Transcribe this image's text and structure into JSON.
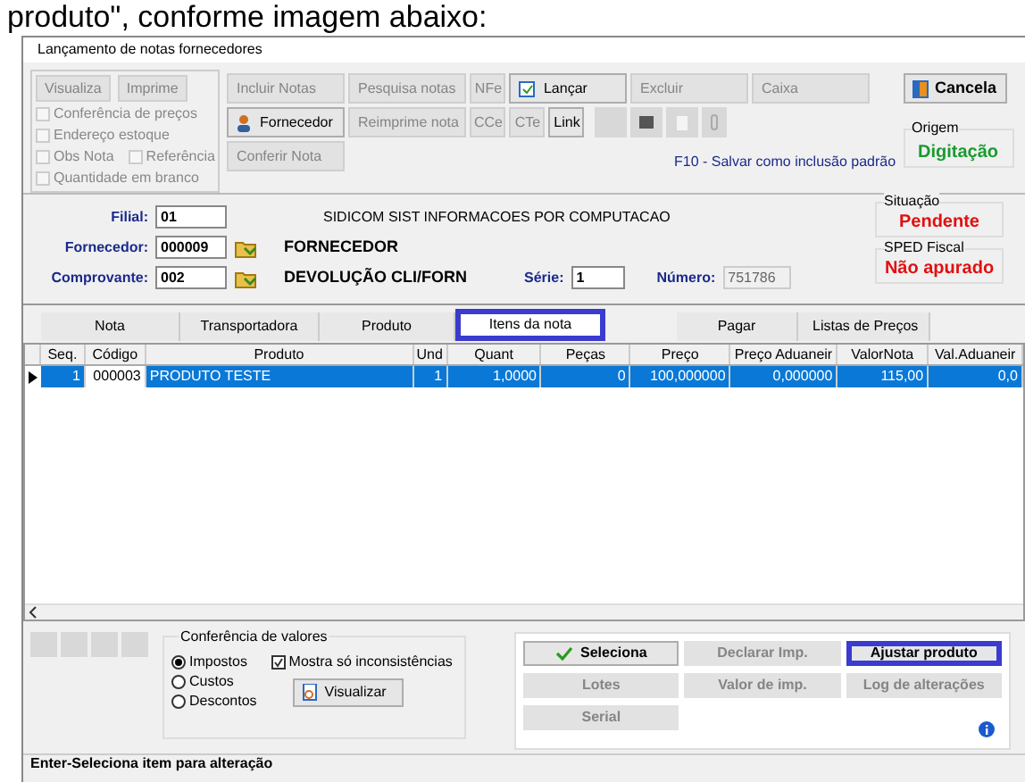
{
  "heading": "produto\", conforme imagem abaixo:",
  "window": {
    "title": "Lançamento de notas fornecedores"
  },
  "left_tools": {
    "buttons": [
      {
        "label": "Visualiza",
        "disabled": true
      },
      {
        "label": "Imprime",
        "disabled": true
      }
    ],
    "option_rows": [
      {
        "items": [
          {
            "label": "Conferência de preços",
            "checked": false
          }
        ]
      },
      {
        "items": [
          {
            "label": "Endereço estoque",
            "checked": false
          }
        ]
      },
      {
        "items": [
          {
            "label": "Obs Nota",
            "checked": false
          },
          {
            "label": "Referência",
            "checked": false
          }
        ]
      },
      {
        "items": [
          {
            "label": "Quantidade em branco",
            "checked": false
          }
        ]
      }
    ]
  },
  "toolbar": {
    "rows": [
      {
        "buttons": [
          {
            "label": "Incluir Notas",
            "disabled": true,
            "kind": "wide"
          },
          {
            "label": "Pesquisa notas",
            "disabled": true,
            "kind": "wide"
          },
          {
            "label": "NFe",
            "disabled": true,
            "kind": "small"
          },
          {
            "label": "Lançar",
            "disabled": false,
            "kind": "wide"
          },
          {
            "label": "Excluir",
            "disabled": true,
            "kind": "wide"
          },
          {
            "label": "Caixa",
            "disabled": true,
            "kind": "wide"
          }
        ]
      },
      {
        "buttons": [
          {
            "label": "Fornecedor",
            "disabled": false,
            "kind": "wide"
          },
          {
            "label": "Reimprime nota",
            "disabled": true,
            "kind": "wide"
          },
          {
            "label": "CCe",
            "disabled": true,
            "kind": "small"
          },
          {
            "label": "CTe",
            "disabled": true,
            "kind": "small"
          },
          {
            "label": "Link",
            "disabled": false,
            "kind": "small"
          }
        ]
      },
      {
        "buttons": [
          {
            "label": "Conferir Nota",
            "disabled": true,
            "kind": "wide"
          }
        ]
      }
    ],
    "cancel": {
      "label": "Cancela",
      "disabled": false
    },
    "hint": "F10 - Salvar como inclusão padrão"
  },
  "origin": {
    "label": "Origem",
    "value": "Digitação"
  },
  "fields": {
    "filial": {
      "label": "Filial:",
      "value": "01",
      "name": "SIDICOM SIST INFORMACOES POR COMPUTACAO"
    },
    "fornecedor": {
      "label": "Fornecedor:",
      "value": "000009",
      "name": "FORNECEDOR"
    },
    "comprovante": {
      "label": "Comprovante:",
      "value": "002",
      "name": "DEVOLUÇÃO CLI/FORN"
    },
    "serie": {
      "label": "Série:",
      "value": "1"
    },
    "numero": {
      "label": "Número:",
      "value": "751786",
      "disabled": true
    }
  },
  "situacao": {
    "label": "Situação",
    "value": "Pendente"
  },
  "sped": {
    "label": "SPED Fiscal",
    "value": "Não apurado"
  },
  "tabs": [
    {
      "label": "Nota",
      "selected": false,
      "highlighted": false
    },
    {
      "label": "Transportadora",
      "selected": false,
      "highlighted": false
    },
    {
      "label": "Produto",
      "selected": false,
      "highlighted": false
    },
    {
      "label": "Itens da nota",
      "selected": true,
      "highlighted": true
    },
    {
      "label": "Pagar",
      "selected": false,
      "highlighted": false
    },
    {
      "label": "Listas de Preços",
      "selected": false,
      "highlighted": false
    }
  ],
  "table": {
    "columns": [
      "Seq.",
      "Código",
      "Produto",
      "Und",
      "Quant",
      "Peças",
      "Preço",
      "Preço Aduaneir",
      "ValorNota",
      "Val.Aduaneir"
    ],
    "rows": [
      {
        "cells": [
          "1",
          "000003",
          "PRODUTO TESTE",
          "1",
          "1,0000",
          "0",
          "100,000000",
          "0,000000",
          "115,00",
          "0,0"
        ],
        "selected": true
      }
    ]
  },
  "conference": {
    "title": "Conferência de valores",
    "radios": [
      {
        "label": "Impostos",
        "selected": true
      },
      {
        "label": "Custos",
        "selected": false
      },
      {
        "label": "Descontos",
        "selected": false
      }
    ],
    "checkbox": {
      "label": "Mostra só inconsistências",
      "checked": true
    },
    "button": "Visualizar"
  },
  "actions": [
    {
      "label": "Seleciona",
      "disabled": false,
      "highlighted": false,
      "kind": "default"
    },
    {
      "label": "Declarar Imp.",
      "disabled": true,
      "highlighted": false,
      "kind": "plain"
    },
    {
      "label": "Ajustar produto",
      "disabled": false,
      "highlighted": true,
      "kind": "plain"
    },
    {
      "label": "Lotes",
      "disabled": true,
      "highlighted": false,
      "kind": "plain"
    },
    {
      "label": "Valor de imp.",
      "disabled": true,
      "highlighted": false,
      "kind": "plain"
    },
    {
      "label": "Log de alterações",
      "disabled": true,
      "highlighted": false,
      "kind": "plain"
    },
    {
      "label": "Serial",
      "disabled": true,
      "highlighted": false,
      "kind": "plain"
    }
  ],
  "status_bar": "Enter-Seleciona item para alteração"
}
